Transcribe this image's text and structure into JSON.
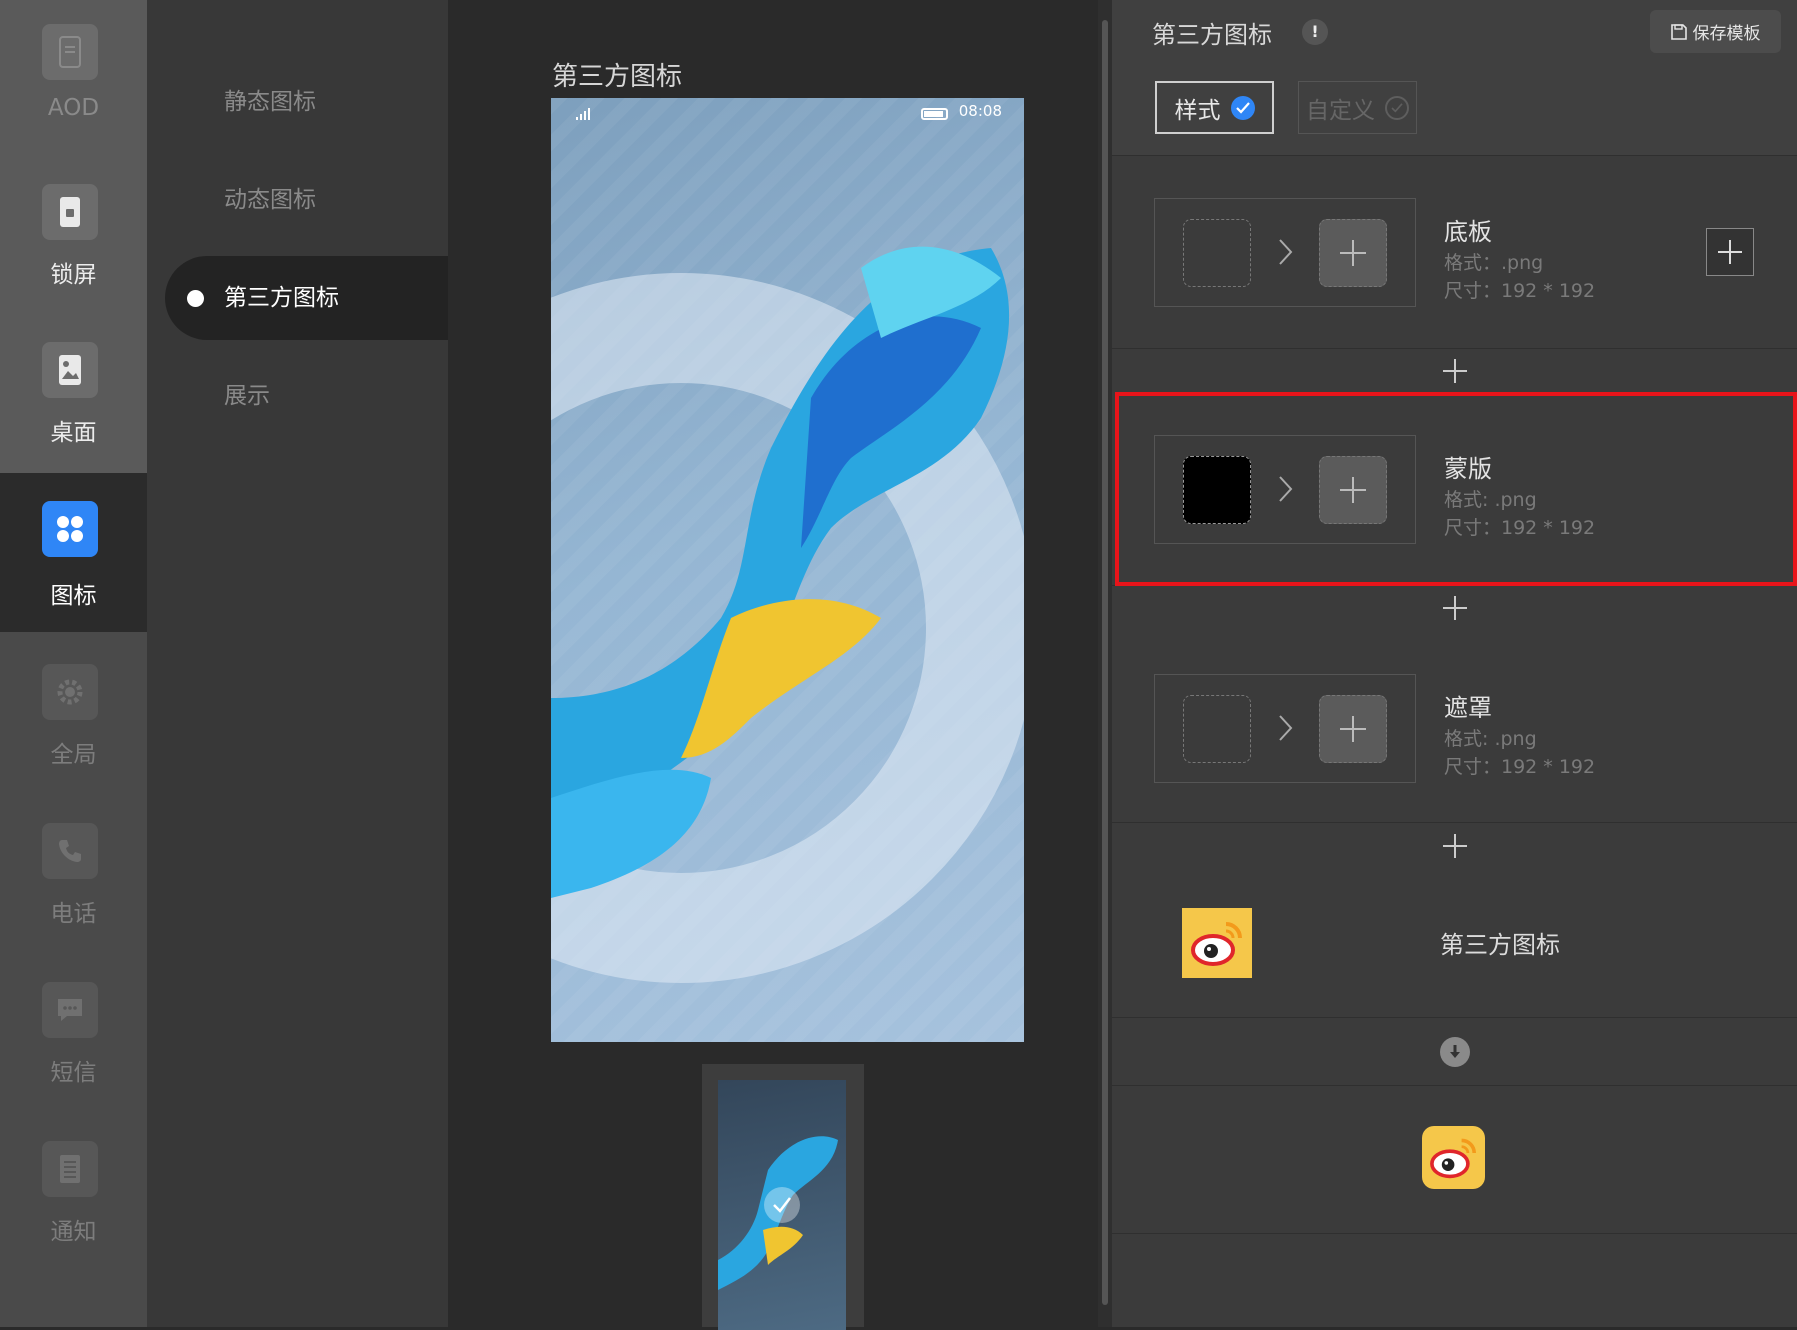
{
  "rail": {
    "items": [
      {
        "label": "AOD",
        "icon": "aod-icon"
      },
      {
        "label": "锁屏",
        "icon": "lock-screen-icon"
      },
      {
        "label": "桌面",
        "icon": "desktop-icon"
      },
      {
        "label": "图标",
        "icon": "icons-grid-icon"
      },
      {
        "label": "全局",
        "icon": "gear-icon"
      },
      {
        "label": "电话",
        "icon": "phone-icon"
      },
      {
        "label": "短信",
        "icon": "message-icon"
      },
      {
        "label": "通知",
        "icon": "notification-icon"
      }
    ],
    "active_index": 3
  },
  "submenu": {
    "items": [
      {
        "label": "静态图标"
      },
      {
        "label": "动态图标"
      },
      {
        "label": "第三方图标"
      },
      {
        "label": "展示"
      }
    ],
    "active_index": 2
  },
  "preview": {
    "title": "第三方图标",
    "status_time": "08:08"
  },
  "panel": {
    "title": "第三方图标",
    "info_icon": "!",
    "save_label": "保存模板",
    "modes": [
      {
        "label": "样式",
        "selected": true
      },
      {
        "label": "自定义",
        "selected": false
      }
    ],
    "layers": [
      {
        "name": "底板",
        "format": "格式：.png",
        "size": "尺寸：192 * 192"
      },
      {
        "name": "蒙版",
        "format": "格式: .png",
        "size": "尺寸：192 * 192"
      },
      {
        "name": "遮罩",
        "format": "格式: .png",
        "size": "尺寸：192 * 192"
      }
    ],
    "third_party_label": "第三方图标"
  },
  "colors": {
    "accent": "#2f86f6",
    "highlight": "#e8141a",
    "app_icon_bg": "#f5c74a"
  }
}
